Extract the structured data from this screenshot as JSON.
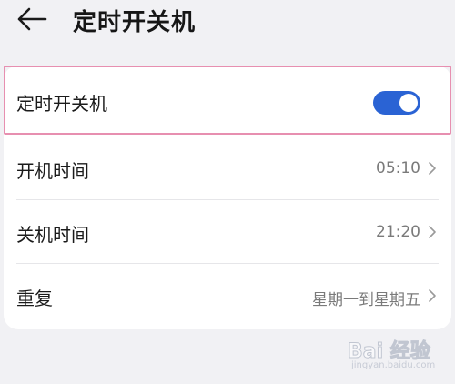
{
  "header": {
    "title": "定时开关机",
    "back_icon": "arrow-left-icon"
  },
  "settings": {
    "auto_power": {
      "label": "定时开关机",
      "enabled": true,
      "toggle_color": "#2a63d4"
    },
    "power_on": {
      "label": "开机时间",
      "value": "05:10"
    },
    "power_off": {
      "label": "关机时间",
      "value": "21:20"
    },
    "repeat": {
      "label": "重复",
      "value": "星期一到星期五"
    }
  },
  "watermark": {
    "logo": "Bai 经验",
    "url": "jingyan.baidu.com"
  },
  "colors": {
    "highlight_border": "#e78fb0",
    "background": "#f1f1f4"
  }
}
